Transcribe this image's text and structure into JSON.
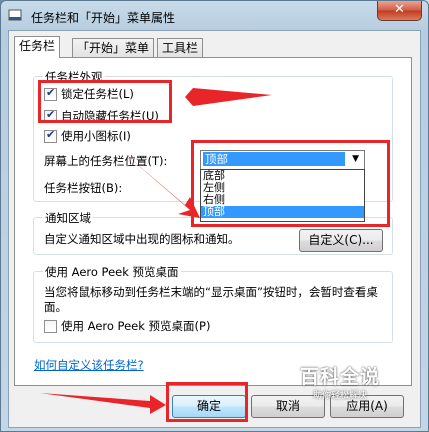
{
  "window": {
    "title": "任务栏和「开始」菜单属性",
    "close_glyph": "✕"
  },
  "tabs": [
    {
      "label": "任务栏"
    },
    {
      "label": "「开始」菜单"
    },
    {
      "label": "工具栏"
    }
  ],
  "appearance": {
    "legend": "任务栏外观",
    "lock": {
      "label": "锁定任务栏(L)",
      "checked": true
    },
    "autohide": {
      "label": "自动隐藏任务栏(U)",
      "checked": true
    },
    "small_icons": {
      "label": "使用小图标(I)",
      "checked": true
    },
    "position_label": "屏幕上的任务栏位置(T):",
    "position_value": "顶部",
    "position_options": [
      "底部",
      "左侧",
      "右侧",
      "顶部"
    ],
    "buttons_label": "任务栏按钮(B):"
  },
  "notify": {
    "legend": "通知区域",
    "text": "自定义通知区域中出现的图标和通知。",
    "button": "自定义(C)..."
  },
  "peek": {
    "legend": "使用 Aero Peek 预览桌面",
    "text": "当您将鼠标移动到任务栏末端的“显示桌面”按钮时，会暂时查看桌面。",
    "checkbox": {
      "label": "使用 Aero Peek 预览桌面(P)",
      "checked": false
    }
  },
  "link": "如何自定义该任务栏?",
  "footer": {
    "ok": "确定",
    "cancel": "取消",
    "apply": "应用(A)"
  },
  "watermark": {
    "main": "百科全说",
    "sub": "助你轻松解决"
  },
  "colors": {
    "accent": "#3399ff",
    "annotation": "#e8262a"
  }
}
